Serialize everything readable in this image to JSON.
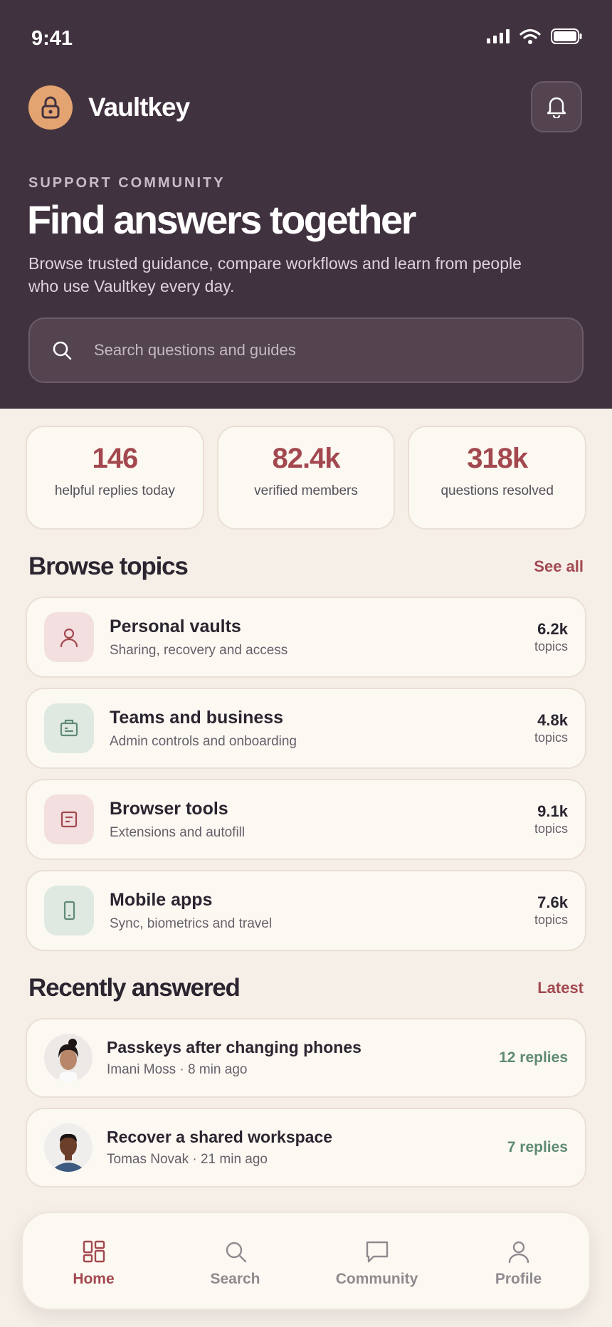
{
  "status": {
    "time": "9:41"
  },
  "brand": {
    "name": "Vaultkey"
  },
  "hero": {
    "eyebrow": "SUPPORT COMMUNITY",
    "headline": "Find answers together",
    "subtitle": "Browse trusted guidance, compare workflows and learn from people who use Vaultkey every day.",
    "search_placeholder": "Search questions and guides"
  },
  "stats": [
    {
      "value": "146",
      "label": "helpful replies today"
    },
    {
      "value": "82.4k",
      "label": "verified members"
    },
    {
      "value": "318k",
      "label": "questions resolved"
    }
  ],
  "browse": {
    "title": "Browse topics",
    "link": "See all",
    "topics": [
      {
        "title": "Personal vaults",
        "desc": "Sharing, recovery and access",
        "count": "6.2k",
        "unit": "topics",
        "icon": "person-icon"
      },
      {
        "title": "Teams and business",
        "desc": "Admin controls and onboarding",
        "count": "4.8k",
        "unit": "topics",
        "icon": "briefcase-icon"
      },
      {
        "title": "Browser tools",
        "desc": "Extensions and autofill",
        "count": "9.1k",
        "unit": "topics",
        "icon": "document-icon"
      },
      {
        "title": "Mobile apps",
        "desc": "Sync, biometrics and travel",
        "count": "7.6k",
        "unit": "topics",
        "icon": "phone-icon"
      }
    ]
  },
  "recent": {
    "title": "Recently answered",
    "link": "Latest",
    "posts": [
      {
        "title": "Passkeys after changing phones",
        "meta": "Imani Moss · 8 min ago",
        "replies": "12 replies"
      },
      {
        "title": "Recover a shared workspace",
        "meta": "Tomas Novak · 21 min ago",
        "replies": "7 replies"
      }
    ]
  },
  "tabs": [
    {
      "label": "Home",
      "icon": "home-grid-icon",
      "active": true
    },
    {
      "label": "Search",
      "icon": "search-icon",
      "active": false
    },
    {
      "label": "Community",
      "icon": "chat-icon",
      "active": false
    },
    {
      "label": "Profile",
      "icon": "person-icon",
      "active": false
    }
  ],
  "colors": {
    "hero_bg": "#41323f",
    "accent": "#a3484f",
    "brand_badge": "#e3a471",
    "replies_green": "#5f8a74",
    "page_bg": "#f5efe8"
  }
}
